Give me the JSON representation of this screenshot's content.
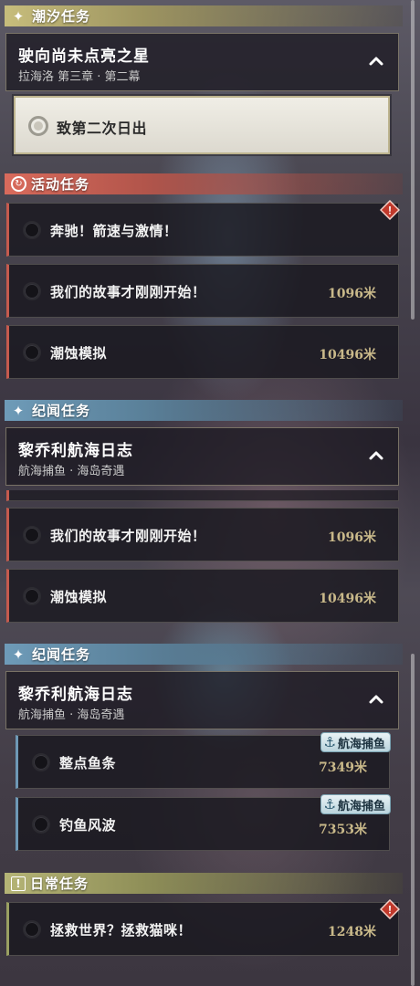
{
  "sections": {
    "tide": {
      "label": "潮汐任务",
      "icon": "sparkle-icon"
    },
    "activity": {
      "label": "活动任务",
      "icon": "activity-icon"
    },
    "news1": {
      "label": "纪闻任务",
      "icon": "sparkle-icon"
    },
    "news2": {
      "label": "纪闻任务",
      "icon": "sparkle-icon"
    },
    "daily": {
      "label": "日常任务",
      "icon": "exclamation-box-icon"
    }
  },
  "tide_group": {
    "title": "驶向尚未点亮之星",
    "subtitle": "拉海洛 第三章 · 第二幕"
  },
  "tide_quest": {
    "name": "致第二次日出"
  },
  "activity_quests": [
    {
      "name": "奔驰！箭速与激情！",
      "distance": ""
    },
    {
      "name": "我们的故事才刚刚开始！",
      "distance": "1096米"
    },
    {
      "name": "潮蚀模拟",
      "distance": "10496米"
    }
  ],
  "news_group1": {
    "title": "黎乔利航海日志",
    "subtitle": "航海捕鱼 · 海岛奇遇"
  },
  "activity_quests2": [
    {
      "name": "我们的故事才刚刚开始！",
      "distance": "1096米"
    },
    {
      "name": "潮蚀模拟",
      "distance": "10496米"
    }
  ],
  "news_group2": {
    "title": "黎乔利航海日志",
    "subtitle": "航海捕鱼 · 海岛奇遇"
  },
  "news_quests": [
    {
      "name": "整点鱼条",
      "distance": "7349米",
      "tag": "航海捕鱼"
    },
    {
      "name": "钓鱼风波",
      "distance": "7353米",
      "tag": "航海捕鱼"
    }
  ],
  "daily_quests": [
    {
      "name": "拯救世界？拯救猫咪！",
      "distance": "1248米"
    }
  ],
  "icons": {
    "warn": "!",
    "anchor": "⚓"
  },
  "colors": {
    "tide": "#c7bd7c",
    "activity": "#d96b5c",
    "news": "#6e9bb8",
    "daily": "#b5b476",
    "distance": "#c9b98a"
  }
}
